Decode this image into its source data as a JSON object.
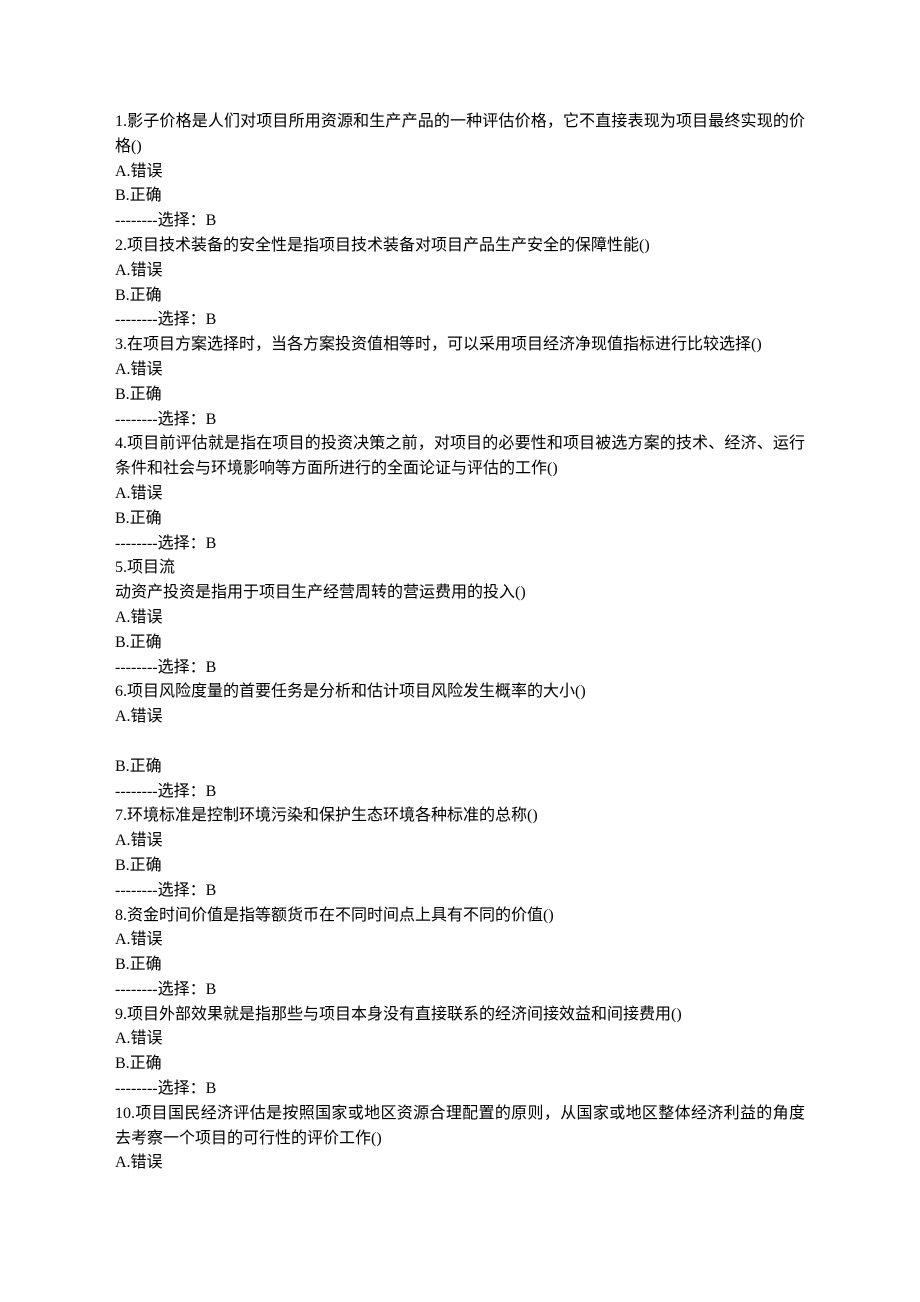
{
  "answer_prefix": "--------选择：",
  "questions": [
    {
      "num": "1",
      "text": "影子价格是人们对项目所用资源和生产产品的一种评估价格，它不直接表现为项目最终实现的价格()",
      "optA": "A.错误",
      "optB": "B.正确",
      "answer": "B"
    },
    {
      "num": "2",
      "text": "项目技术装备的安全性是指项目技术装备对项目产品生产安全的保障性能()",
      "optA": "A.错误",
      "optB": "B.正确",
      "answer": "B"
    },
    {
      "num": "3",
      "text": "在项目方案选择时，当各方案投资值相等时，可以采用项目经济净现值指标进行比较选择()",
      "optA": "A.错误",
      "optB": "B.正确",
      "answer": "B"
    },
    {
      "num": "4",
      "text": "项目前评估就是指在项目的投资决策之前，对项目的必要性和项目被选方案的技术、经济、运行条件和社会与环境影响等方面所进行的全面论证与评估的工作()",
      "optA": "A.错误",
      "optB": "B.正确",
      "answer": "B"
    },
    {
      "num": "5",
      "text_line1": "项目流",
      "text_line2": "动资产投资是指用于项目生产经营周转的营运费用的投入()",
      "optA": "A.错误",
      "optB": "B.正确",
      "answer": "B"
    },
    {
      "num": "6",
      "text": "项目风险度量的首要任务是分析和估计项目风险发生概率的大小()",
      "optA": "A.错误",
      "optB": "B.正确",
      "answer": "B",
      "gap_after_A": true
    },
    {
      "num": "7",
      "text": "环境标准是控制环境污染和保护生态环境各种标准的总称()",
      "optA": "A.错误",
      "optB": "B.正确",
      "answer": "B"
    },
    {
      "num": "8",
      "text": "资金时间价值是指等额货币在不同时间点上具有不同的价值()",
      "optA": "A.错误",
      "optB": "B.正确",
      "answer": "B"
    },
    {
      "num": "9",
      "text": "项目外部效果就是指那些与项目本身没有直接联系的经济间接效益和间接费用()",
      "optA": "A.错误",
      "optB": "B.正确",
      "answer": "B"
    },
    {
      "num": "10",
      "text": "项目国民经济评估是按照国家或地区资源合理配置的原则，从国家或地区整体经济利益的角度去考察一个项目的可行性的评价工作()",
      "optA": "A.错误"
    }
  ]
}
